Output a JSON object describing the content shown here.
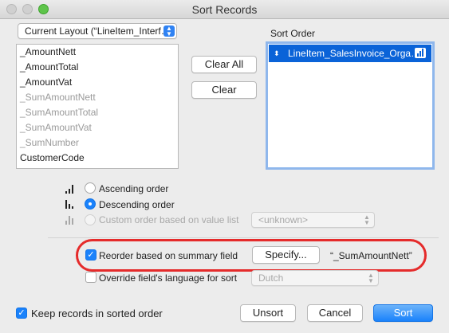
{
  "window": {
    "title": "Sort Records"
  },
  "layout_popup": {
    "value": "Current Layout (“LineItem_Interf…"
  },
  "field_list": {
    "items": [
      {
        "label": "_AmountNett",
        "dim": false
      },
      {
        "label": "_AmountTotal",
        "dim": false
      },
      {
        "label": "_AmountVat",
        "dim": false
      },
      {
        "label": "_SumAmountNett",
        "dim": true
      },
      {
        "label": "_SumAmountTotal",
        "dim": true
      },
      {
        "label": "_SumAmountVat",
        "dim": true
      },
      {
        "label": "_SumNumber",
        "dim": true
      },
      {
        "label": "CustomerCode",
        "dim": false
      }
    ]
  },
  "buttons": {
    "clear_all": "Clear All",
    "clear": "Clear",
    "specify": "Specify...",
    "unsort": "Unsort",
    "cancel": "Cancel",
    "sort": "Sort"
  },
  "sort_order": {
    "label": "Sort Order",
    "selected_row": "LineItem_SalesInvoice_Orga…",
    "updown_glyph": "⬍"
  },
  "order_options": {
    "ascending": "Ascending order",
    "descending": "Descending order",
    "custom": "Custom order based on value list",
    "custom_popup": "<unknown>"
  },
  "summary": {
    "reorder_label": "Reorder based on summary field",
    "summary_field": "“_SumAmountNett”",
    "override_label": "Override field's language for sort",
    "language_popup": "Dutch"
  },
  "footer": {
    "keep_sorted_label": "Keep records in sorted order"
  },
  "colors": {
    "accent": "#1a82fb",
    "selection": "#0a63d8",
    "highlight_ring": "#e52b2b"
  }
}
